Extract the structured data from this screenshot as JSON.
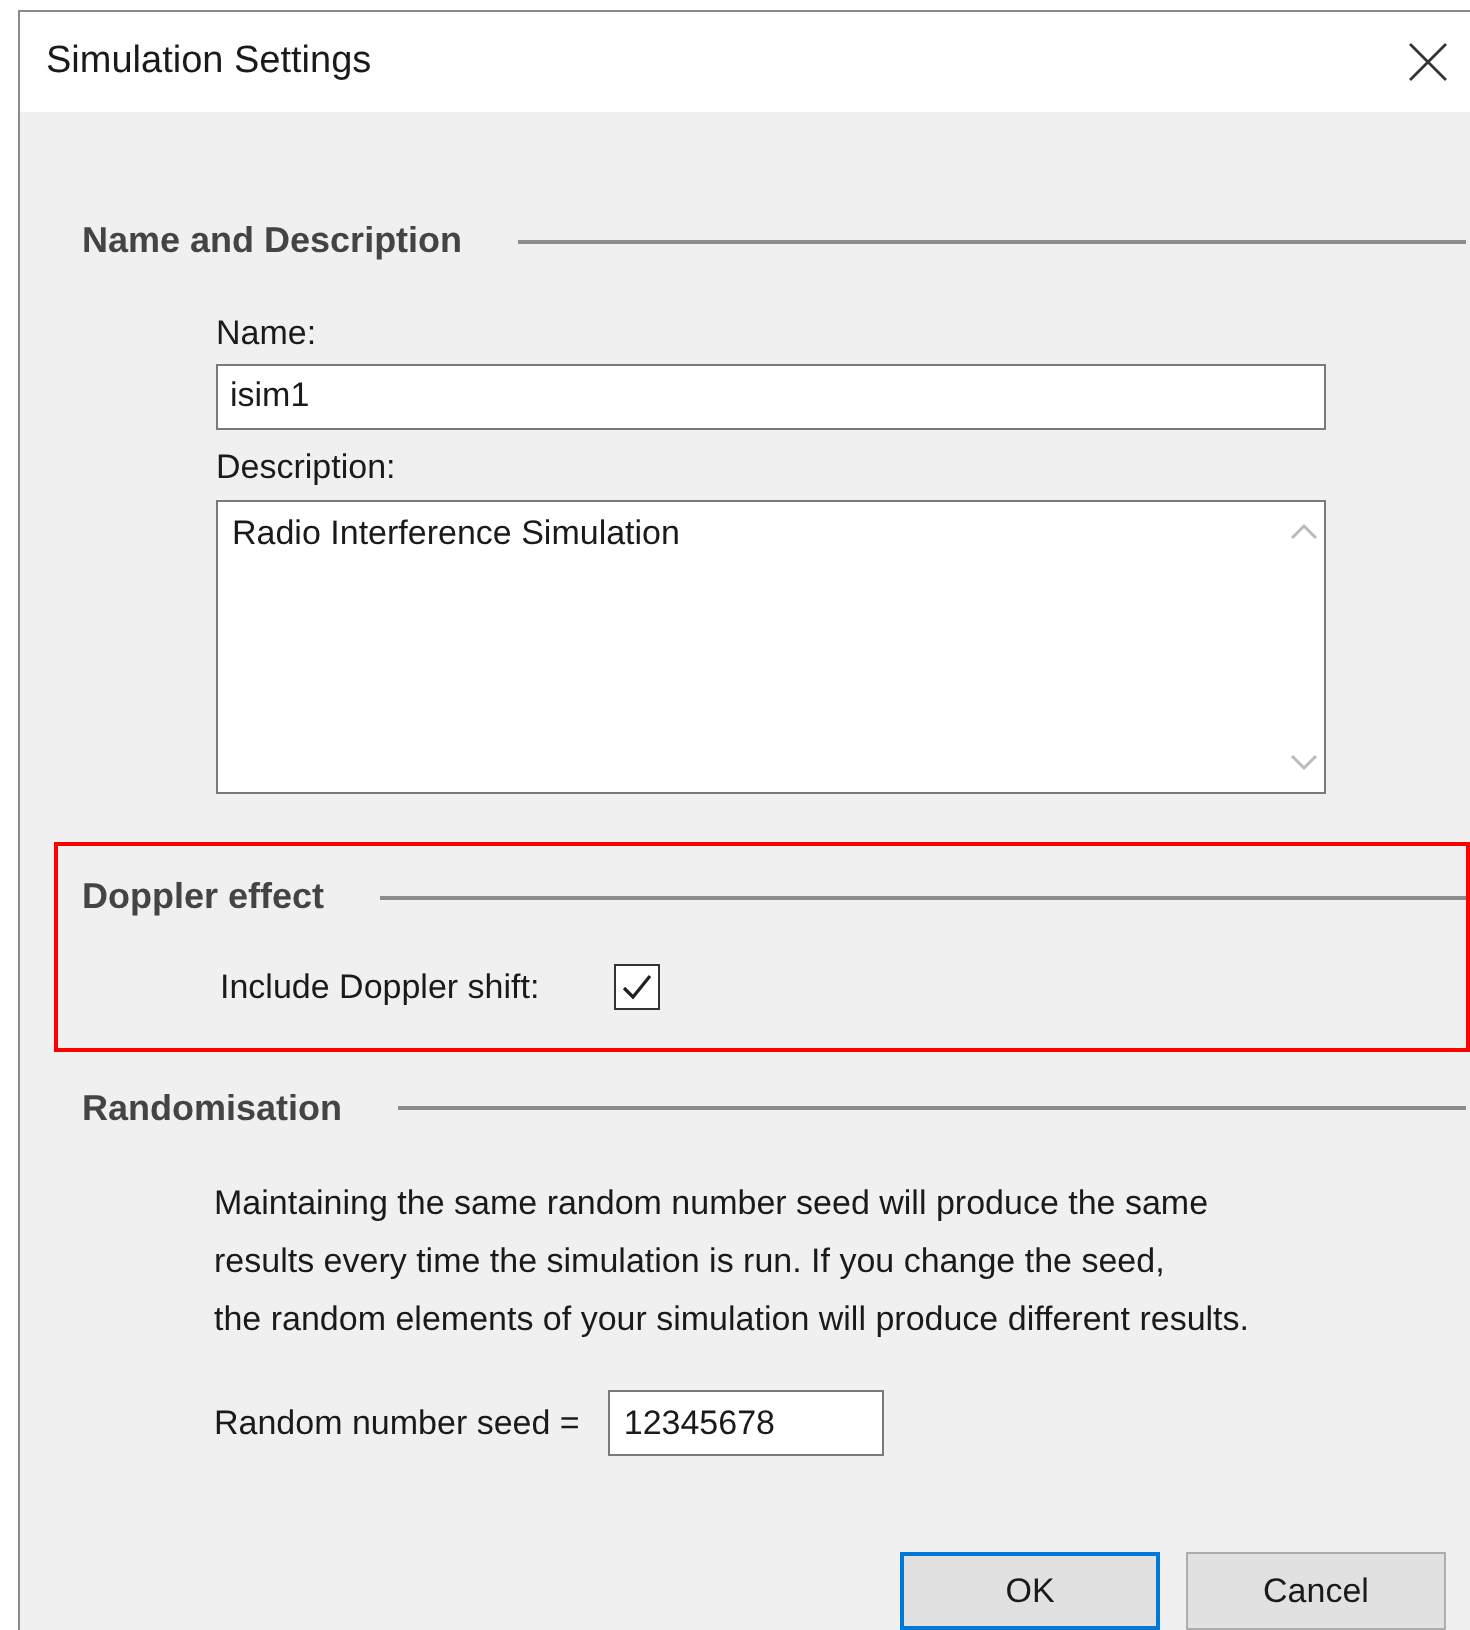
{
  "window": {
    "title": "Simulation Settings"
  },
  "sections": [
    {
      "kind": "name_description",
      "title": "Name and Description",
      "highlighted": false,
      "name_label": "Name:",
      "name_value": "isim1",
      "description_label": "Description:",
      "description_value": "Radio Interference Simulation"
    },
    {
      "kind": "doppler",
      "title": "Doppler effect",
      "highlighted": true,
      "checkbox_label": "Include Doppler shift:",
      "checked": true
    },
    {
      "kind": "randomisation",
      "title": "Randomisation",
      "highlighted": false,
      "paragraph_lines": [
        "Maintaining the same random number seed will produce the same",
        "results every time the simulation is run. If you change the seed,",
        "the random elements of your simulation will produce different results."
      ],
      "seed_label": "Random number seed =",
      "seed_value": "12345678"
    }
  ],
  "buttons": [
    {
      "label": "OK",
      "default": true
    },
    {
      "label": "Cancel",
      "default": false
    }
  ]
}
